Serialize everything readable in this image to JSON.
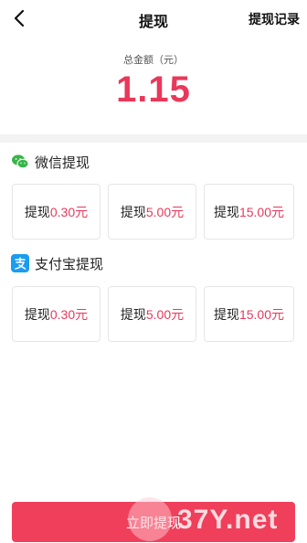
{
  "nav": {
    "title": "提现",
    "records": "提现记录"
  },
  "summary": {
    "label": "总金额（元）",
    "amount": "1.15"
  },
  "wechat": {
    "title": "微信提现",
    "options": [
      {
        "prefix": "提现",
        "amount": "0.30元"
      },
      {
        "prefix": "提现",
        "amount": "5.00元"
      },
      {
        "prefix": "提现",
        "amount": "15.00元"
      }
    ]
  },
  "alipay": {
    "title": "支付宝提现",
    "options": [
      {
        "prefix": "提现",
        "amount": "0.30元"
      },
      {
        "prefix": "提现",
        "amount": "5.00元"
      },
      {
        "prefix": "提现",
        "amount": "15.00元"
      }
    ]
  },
  "button": {
    "label": "立即提现"
  },
  "watermark": {
    "text": "37Y.net"
  },
  "colors": {
    "accent": "#e9385a",
    "button": "#ef3f5b",
    "wechat_green": "#39b54a",
    "alipay_blue": "#1a9cf0"
  }
}
